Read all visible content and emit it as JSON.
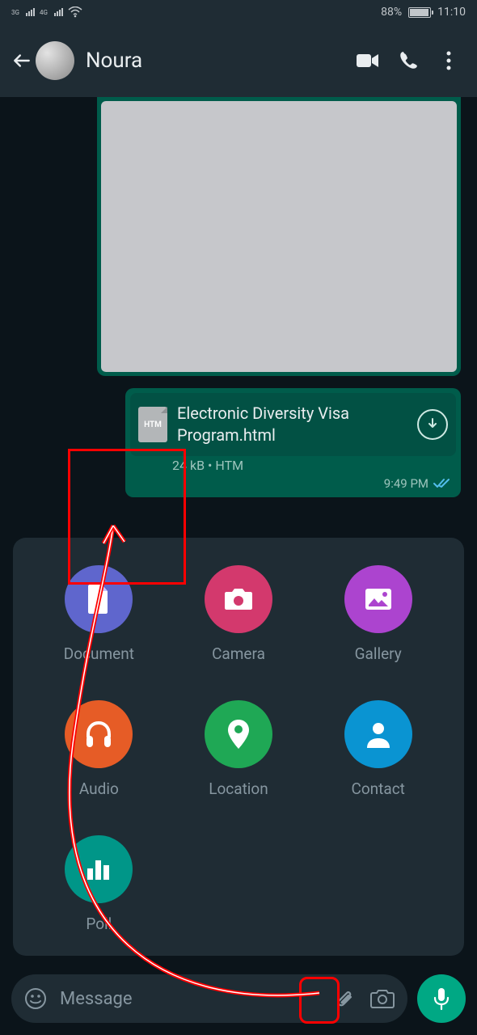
{
  "status": {
    "net1": "3G",
    "net2": "4G",
    "battery_pct": "88%",
    "time": "11:10"
  },
  "header": {
    "contact_name": "Noura"
  },
  "messages": {
    "file": {
      "badge": "HTM",
      "name": "Electronic Diversity Visa Program.html",
      "size": "24 kB",
      "sep": "•",
      "ext": "HTM",
      "time": "9:49 PM"
    }
  },
  "attach": {
    "document": "Document",
    "camera": "Camera",
    "gallery": "Gallery",
    "audio": "Audio",
    "location": "Location",
    "contact": "Contact",
    "poll": "Poll"
  },
  "input": {
    "placeholder": "Message"
  }
}
